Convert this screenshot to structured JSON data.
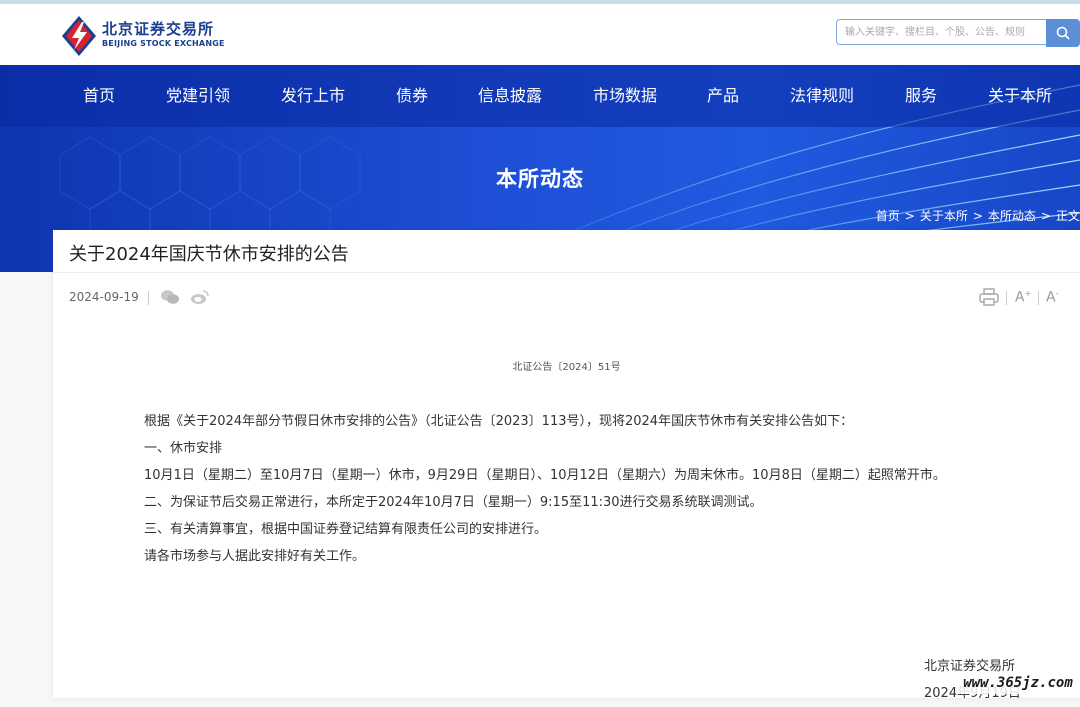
{
  "site": {
    "name_cn": "北京证券交易所",
    "name_en": "BEIJING STOCK EXCHANGE"
  },
  "search": {
    "placeholder": "输入关键字、搜栏目、个股、公告、规则"
  },
  "nav": {
    "items": [
      {
        "label": "首页"
      },
      {
        "label": "党建引领"
      },
      {
        "label": "发行上市"
      },
      {
        "label": "债券"
      },
      {
        "label": "信息披露"
      },
      {
        "label": "市场数据"
      },
      {
        "label": "产品"
      },
      {
        "label": "法律规则"
      },
      {
        "label": "服务"
      },
      {
        "label": "关于本所"
      }
    ]
  },
  "hero": {
    "title": "本所动态"
  },
  "breadcrumb": {
    "items": [
      "首页",
      "关于本所",
      "本所动态",
      "正文"
    ],
    "separator": ">"
  },
  "article": {
    "title": "关于2024年国庆节休市安排的公告",
    "date": "2024-09-19",
    "font_increase": "A",
    "font_decrease": "A",
    "font_increase_sup": "+",
    "font_decrease_sup": "-",
    "doc_number": "北证公告〔2024〕51号",
    "paragraphs": [
      "根据《关于2024年部分节假日休市安排的公告》（北证公告〔2023〕113号），现将2024年国庆节休市有关安排公告如下：",
      "一、休市安排",
      "10月1日（星期二）至10月7日（星期一）休市，9月29日（星期日）、10月12日（星期六）为周末休市。10月8日（星期二）起照常开市。",
      "二、为保证节后交易正常进行，本所定于2024年10月7日（星期一）9:15至11:30进行交易系统联调测试。",
      "三、有关清算事宜，根据中国证券登记结算有限责任公司的安排进行。",
      "请各市场参与人据此安排好有关工作。"
    ],
    "signature": "北京证券交易所",
    "sign_date": "2024年9月19日"
  },
  "watermark": "www.365jz.com",
  "colors": {
    "brand_blue": "#1a3f92",
    "nav_bg": "#1e4fd6",
    "search_button": "#5b8fd8"
  },
  "icons": [
    "logo-mark",
    "search-icon",
    "wechat-icon",
    "weibo-icon",
    "print-icon"
  ]
}
